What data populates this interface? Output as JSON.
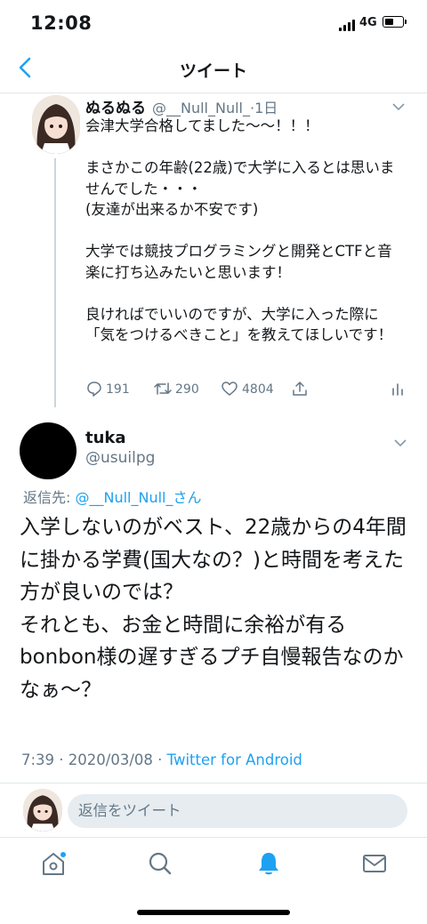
{
  "status_bar": {
    "time": "12:08",
    "network": "4G"
  },
  "header": {
    "title": "ツイート"
  },
  "parent_tweet": {
    "name": "ぬるぬる",
    "handle": "@__Null_Null_",
    "time": "·1日",
    "body": "会津大学合格してました〜〜！！！\n\nまさかこの年齢(22歳)で大学に入るとは思いませんでした・・・\n(友達が出来るか不安です)\n\n大学では競技プログラミングと開発とCTFと音楽に打ち込みたいと思います！\n\n良ければでいいのですが、大学に入った際に「気をつけるべきこと」を教えてほしいです！",
    "replies": "191",
    "retweets": "290",
    "likes": "4804"
  },
  "reply_tweet": {
    "name": "tuka",
    "handle": "@usuilpg",
    "reply_prefix": "返信先: ",
    "reply_to": "@__Null_Null_さん",
    "body": "入学しないのがベスト、22歳からの4年間に掛かる学費(国大なの？)と時間を考えた方が良いのでは？\nそれとも、お金と時間に余裕が有るbonbon様の遅すぎるプチ自慢報告なのかなぁ〜？",
    "timestamp": "7:39 · 2020/03/08 · ",
    "source": "Twitter for Android"
  },
  "composer": {
    "placeholder": "返信をツイート"
  },
  "colors": {
    "accent": "#1da1f2",
    "secondary_text": "#657786",
    "divider": "#e1e8ed"
  },
  "tab_bar": {
    "icons": [
      "home-icon",
      "search-icon",
      "notifications-icon",
      "messages-icon"
    ]
  }
}
